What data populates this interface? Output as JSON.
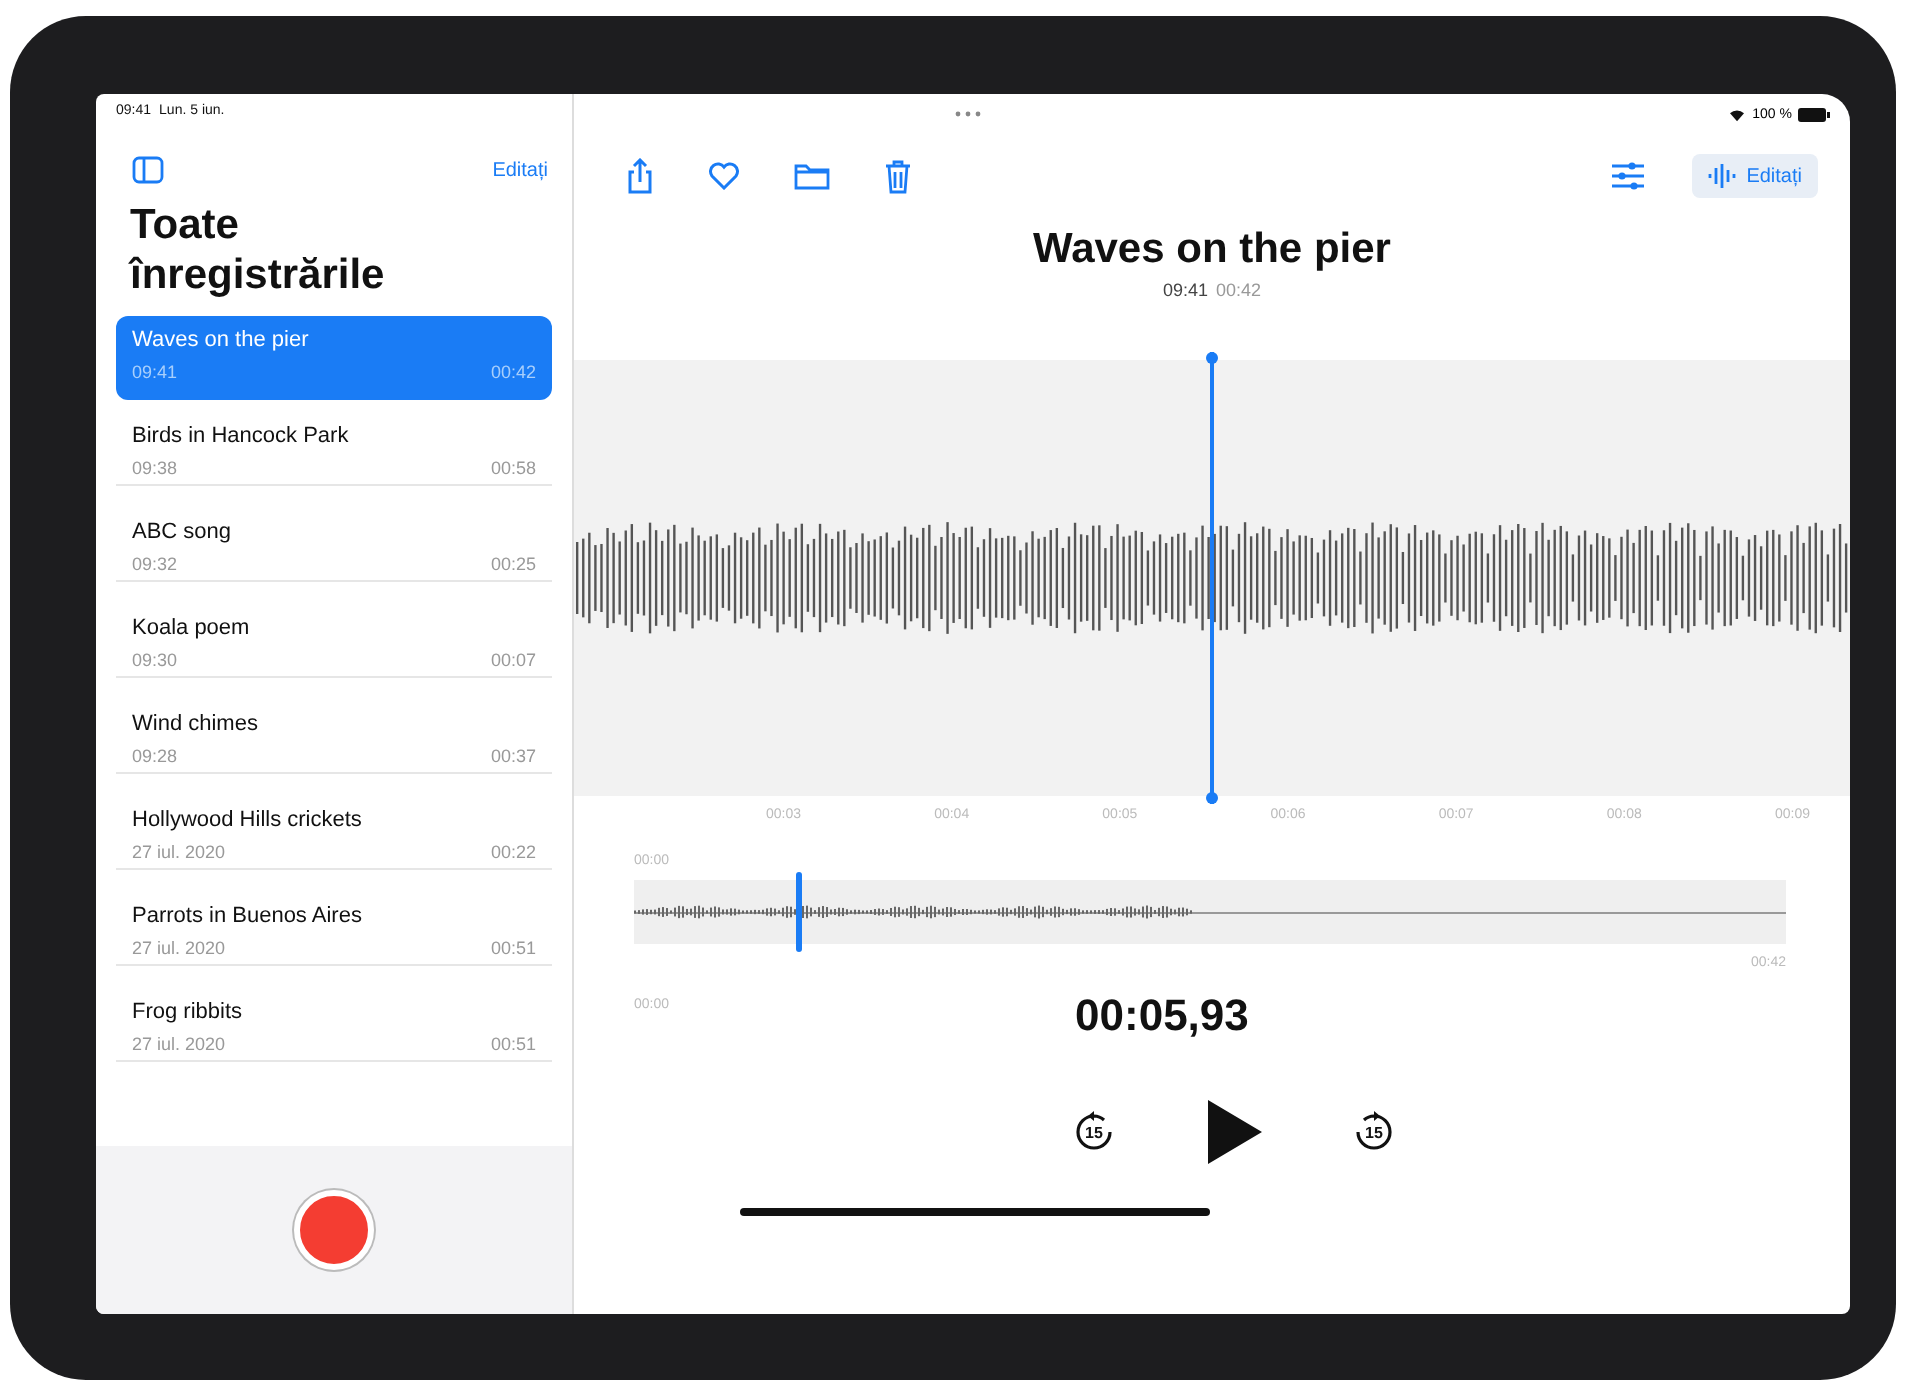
{
  "status_bar": {
    "time": "09:41",
    "date": "Lun. 5 iun.",
    "battery": "100 %"
  },
  "sidebar": {
    "edit": "Editați",
    "title": "Toate înregistrările",
    "recordings": [
      {
        "name": "Waves on the pier",
        "time": "09:41",
        "duration": "00:42",
        "selected": true
      },
      {
        "name": "Birds in Hancock Park",
        "time": "09:38",
        "duration": "00:58",
        "selected": false
      },
      {
        "name": "ABC song",
        "time": "09:32",
        "duration": "00:25",
        "selected": false
      },
      {
        "name": "Koala poem",
        "time": "09:30",
        "duration": "00:07",
        "selected": false
      },
      {
        "name": "Wind chimes",
        "time": "09:28",
        "duration": "00:37",
        "selected": false
      },
      {
        "name": "Hollywood Hills crickets",
        "time": "27 iul. 2020",
        "duration": "00:22",
        "selected": false
      },
      {
        "name": "Parrots in Buenos Aires",
        "time": "27 iul. 2020",
        "duration": "00:51",
        "selected": false
      },
      {
        "name": "Frog ribbits",
        "time": "27 iul. 2020",
        "duration": "00:51",
        "selected": false
      }
    ]
  },
  "toolbar": {
    "edit": "Editați"
  },
  "recording": {
    "title": "Waves on the pier",
    "time": "09:41",
    "duration": "00:42"
  },
  "timeline": {
    "ticks": [
      "00:03",
      "00:04",
      "00:05",
      "00:06",
      "00:07",
      "00:08",
      "00:09"
    ]
  },
  "overview": {
    "start_label": "00:00",
    "end_label": "00:42",
    "position": {
      "level": 0.14
    }
  },
  "player": {
    "elapsed_label": "00:00",
    "timer": "00:05,93",
    "skip_back": "15",
    "skip_forward": "15"
  }
}
